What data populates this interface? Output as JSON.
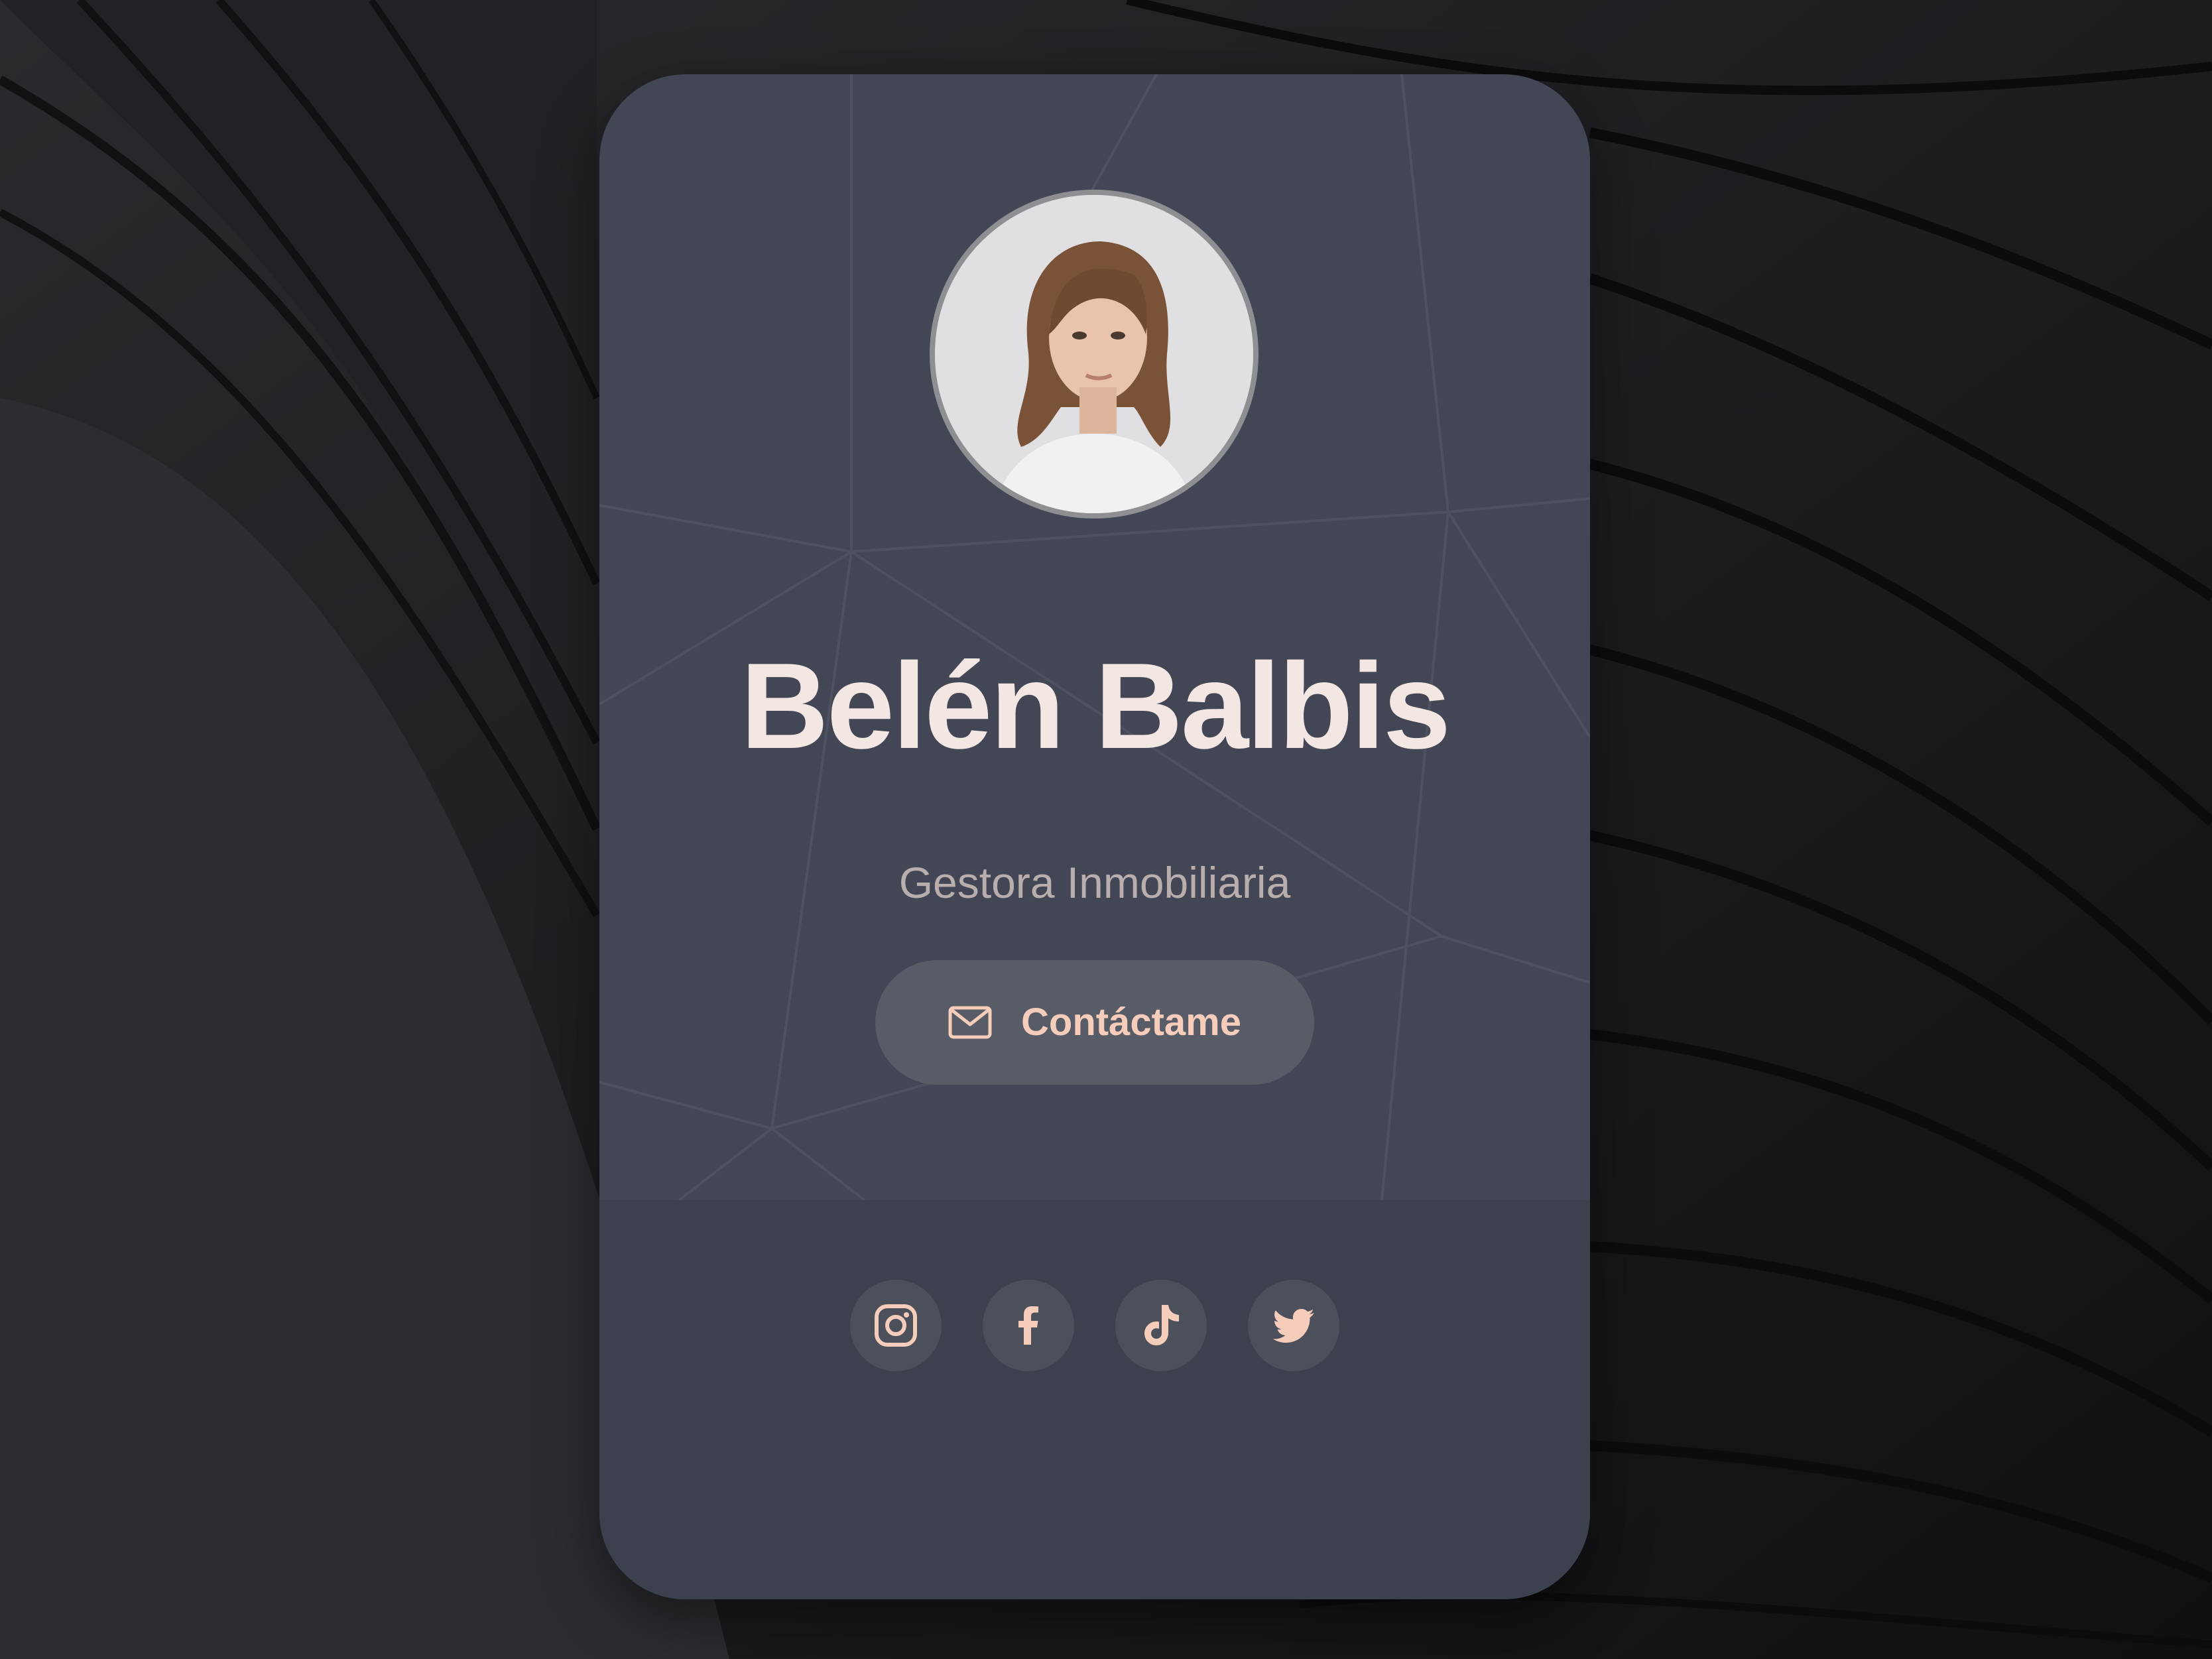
{
  "profile": {
    "name": "Belén Balbis",
    "role": "Gestora Inmobiliaria",
    "avatar_icon": "portrait-photo"
  },
  "contact": {
    "label": "Contáctame",
    "icon": "mail-icon"
  },
  "socials": [
    {
      "icon": "instagram-icon"
    },
    {
      "icon": "facebook-icon"
    },
    {
      "icon": "tiktok-icon"
    },
    {
      "icon": "twitter-icon"
    }
  ],
  "colors": {
    "card": "#434755",
    "card_footer": "#3d414e",
    "accent": "#f6cdbb",
    "name_text": "#f2e7e2",
    "role_text": "#b8aeae",
    "button_bg": "#585c67",
    "social_bg": "#4c505b"
  }
}
